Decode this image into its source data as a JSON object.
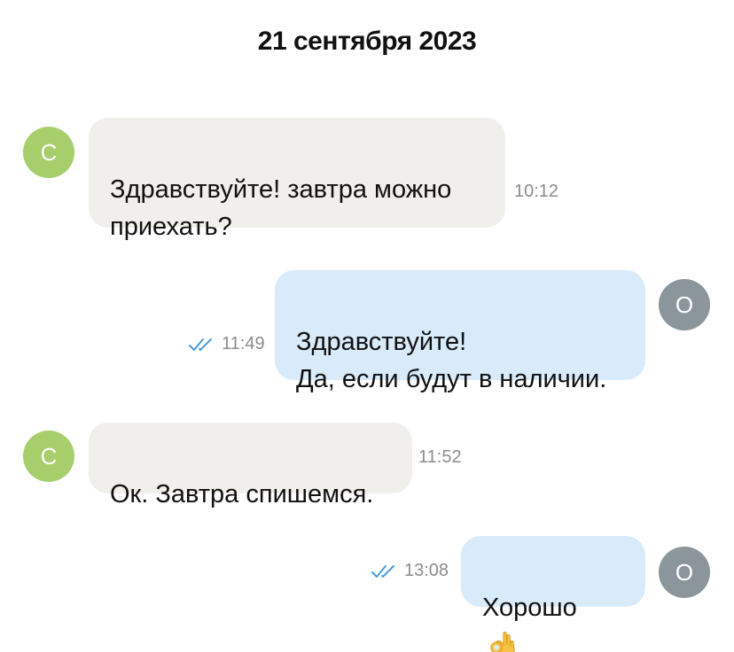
{
  "date_header": "21 сентября 2023",
  "colors": {
    "incoming_bubble": "#f1efeb",
    "outgoing_bubble": "#d8ebfb",
    "incoming_avatar": "#a6cf6c",
    "outgoing_avatar": "#8a959c",
    "read_check": "#4a9bd9"
  },
  "messages": [
    {
      "direction": "incoming",
      "avatar": "С",
      "text": "Здравствуйте! завтра можно\nприехать?",
      "time": "10:12"
    },
    {
      "direction": "outgoing",
      "avatar": "О",
      "text": "Здравствуйте!\nДа, если будут в наличии.",
      "time": "11:49",
      "status_icon": "double-check-icon"
    },
    {
      "direction": "incoming",
      "avatar": "С",
      "text": "Ок. Завтра спишемся.",
      "time": "11:52"
    },
    {
      "direction": "outgoing",
      "avatar": "О",
      "text": "Хорошо",
      "emoji": "ok-hand-emoji-icon",
      "time": "13:08",
      "status_icon": "double-check-icon"
    }
  ]
}
